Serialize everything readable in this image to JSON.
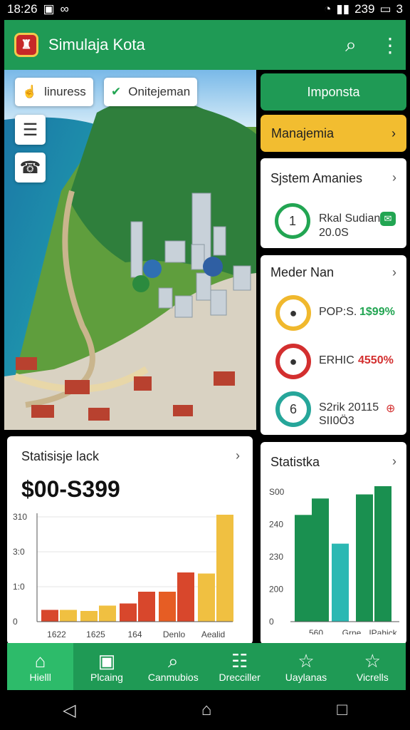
{
  "status": {
    "time": "18:26",
    "right_text": "239",
    "battery": "3"
  },
  "app": {
    "title": "Simulaja Kota"
  },
  "overlay": {
    "pill1": "linuress",
    "pill2": "Onitejeman"
  },
  "side": {
    "imponsta": "Imponsta",
    "manajemia": "Manajemia",
    "system_title": "Sjstem Amanies",
    "system_ring": "1",
    "system_line1": "Rkal Sudian",
    "system_line2": "20.0S",
    "meder_title": "Meder Nan",
    "meder_rows": [
      {
        "label": "POP:S.",
        "value": "1$99%",
        "color": "#22a552"
      },
      {
        "label": "ERHIC",
        "value": "4550%",
        "color": "#d32f2f"
      },
      {
        "label": "S2rik 20115",
        "value": "",
        "sub": "SII0Ö3",
        "ring": "6"
      }
    ]
  },
  "stats_left": {
    "title": "Statisisje lack",
    "value": "$00-S399",
    "chart_data": {
      "type": "bar",
      "categories": [
        "1622",
        "1625",
        "164",
        "Denlo",
        "Aealid"
      ],
      "series": [
        {
          "values": [
            11,
            10,
            17,
            28,
            45
          ]
        },
        {
          "values": [
            11,
            15,
            28,
            46,
            100
          ]
        }
      ],
      "y_ticks": [
        "310",
        "3:0",
        "1:0",
        "0"
      ]
    }
  },
  "stats_right": {
    "title": "Statistka",
    "chart_data": {
      "type": "bar",
      "categories": [
        "560",
        "Grne",
        "IPahick"
      ],
      "values": [
        260,
        190,
        300,
        330
      ],
      "y_ticks": [
        "S00",
        "240",
        "230",
        "200",
        "0"
      ]
    }
  },
  "tabs": [
    {
      "label": "Hielll",
      "icon": "home-icon",
      "active": true
    },
    {
      "label": "Plcaing",
      "icon": "document-icon"
    },
    {
      "label": "Canmubios",
      "icon": "search-icon"
    },
    {
      "label": "Drecciller",
      "icon": "list-icon"
    },
    {
      "label": "Uaylanas",
      "icon": "star-icon"
    },
    {
      "label": "Vicrells",
      "icon": "star-icon"
    }
  ]
}
